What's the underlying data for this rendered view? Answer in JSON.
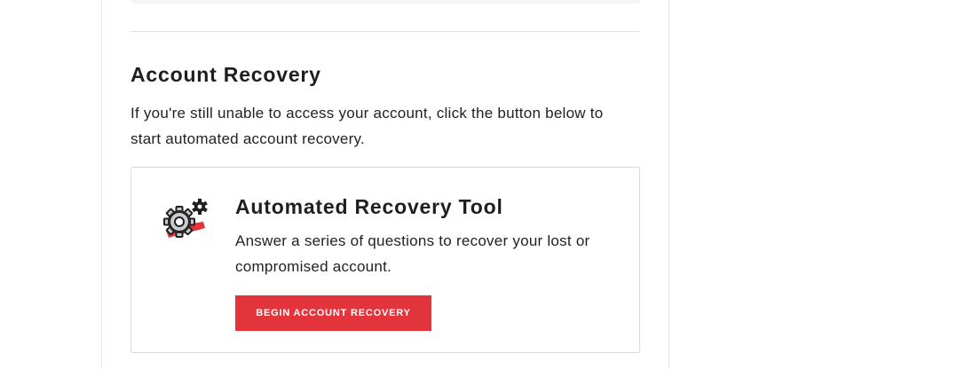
{
  "recovery": {
    "section_title": "Account Recovery",
    "section_description": "If you're still unable to access your account, click the button below to start automated account recovery.",
    "tool": {
      "icon": "gear-settings-icon",
      "title": "Automated Recovery Tool",
      "description": "Answer a series of questions to recover your lost or compromised account.",
      "button_label": "BEGIN ACCOUNT RECOVERY"
    }
  },
  "colors": {
    "accent": "#e3343c",
    "text": "#1f1f1f",
    "border": "#d9d9d9"
  }
}
